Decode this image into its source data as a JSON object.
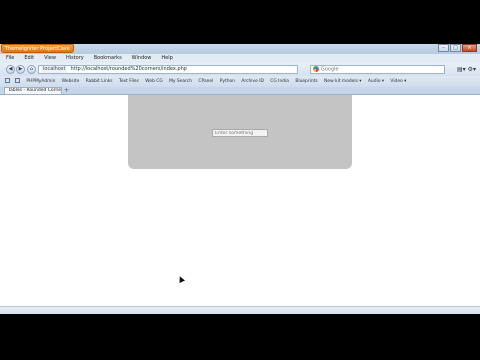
{
  "window": {
    "title": "ThemeIgniter ProjectCave"
  },
  "menu": [
    "File",
    "Edit",
    "View",
    "History",
    "Bookmarks",
    "Window",
    "Help"
  ],
  "nav": {
    "site_badge": "localhost",
    "url": "http://localhost/rounded%20corners/index.php",
    "search_placeholder": "Google"
  },
  "bookmarks": [
    "PHPMyAdmin",
    "Website",
    "Rabbit Links",
    "Text Files",
    "Web CG",
    "My Search",
    "CPanel",
    "Python",
    "Archive ID",
    "CG India",
    "Blueprints",
    "New kit models ▾",
    "Audio ▾",
    "Video ▾"
  ],
  "tab": {
    "label": "Tables - Rounded Corners"
  },
  "page": {
    "input_placeholder": "Enter something"
  }
}
